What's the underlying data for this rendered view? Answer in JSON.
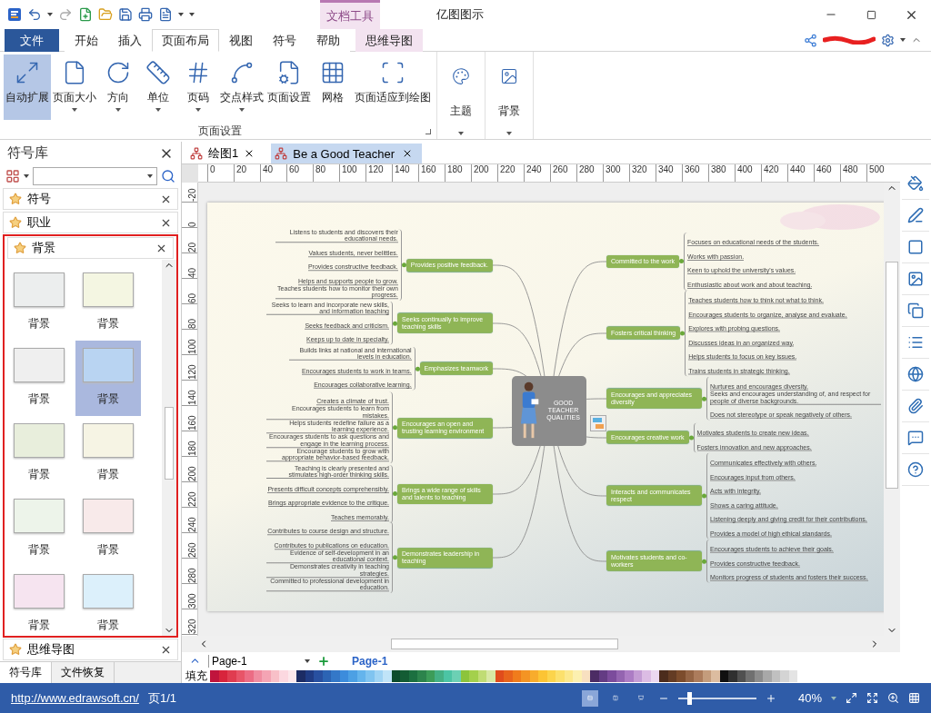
{
  "title_bar": {
    "title": "亿图图示",
    "context_tab": "文档工具"
  },
  "menu_tabs": [
    {
      "label": "文件",
      "kind": "file",
      "selected": false
    },
    {
      "label": "开始",
      "kind": "plain",
      "selected": false
    },
    {
      "label": "插入",
      "kind": "plain",
      "selected": false
    },
    {
      "label": "页面布局",
      "kind": "plain",
      "selected": true
    },
    {
      "label": "视图",
      "kind": "plain",
      "selected": false
    },
    {
      "label": "符号",
      "kind": "plain",
      "selected": false
    },
    {
      "label": "帮助",
      "kind": "plain",
      "selected": false
    },
    {
      "label": "思维导图",
      "kind": "context",
      "selected": false
    }
  ],
  "ribbon": {
    "groups": [
      {
        "label": "页面设置",
        "buttons": [
          {
            "label": "自动扩展",
            "selected": true,
            "dropdown": false
          },
          {
            "label": "页面大小",
            "selected": false,
            "dropdown": true
          },
          {
            "label": "方向",
            "selected": false,
            "dropdown": true
          },
          {
            "label": "单位",
            "selected": false,
            "dropdown": true
          },
          {
            "label": "页码",
            "selected": false,
            "dropdown": true
          },
          {
            "label": "交点样式",
            "selected": false,
            "dropdown": true
          },
          {
            "label": "页面设置",
            "selected": false,
            "dropdown": false
          },
          {
            "label": "网格",
            "selected": false,
            "dropdown": false
          },
          {
            "label": "页面适应到绘图",
            "selected": false,
            "dropdown": false
          }
        ]
      },
      {
        "buttons": [
          {
            "label": "主题",
            "selected": false,
            "dropdown": true
          }
        ]
      },
      {
        "buttons": [
          {
            "label": "背景",
            "selected": false,
            "dropdown": true
          }
        ]
      }
    ]
  },
  "library": {
    "title": "符号库",
    "sections": [
      {
        "label": "符号",
        "expanded": false,
        "highlighted": false
      },
      {
        "label": "职业",
        "expanded": false,
        "highlighted": false
      },
      {
        "label": "背景",
        "expanded": true,
        "highlighted": true
      },
      {
        "label": "思维导图",
        "expanded": false,
        "highlighted": false
      }
    ],
    "thumbnails": [
      {
        "label": "背景",
        "selected": false,
        "color": "#eceeee"
      },
      {
        "label": "背景",
        "selected": false,
        "color": "#f4f6e2"
      },
      {
        "label": "背景",
        "selected": false,
        "color": "#efefef"
      },
      {
        "label": "背景",
        "selected": true,
        "color": "#b9d4f2"
      },
      {
        "label": "背景",
        "selected": false,
        "color": "#e8eedc"
      },
      {
        "label": "背景",
        "selected": false,
        "color": "#f6f4e4"
      },
      {
        "label": "背景",
        "selected": false,
        "color": "#edf4ea"
      },
      {
        "label": "背景",
        "selected": false,
        "color": "#f8eaea"
      },
      {
        "label": "背景",
        "selected": false,
        "color": "#f6e4f0"
      },
      {
        "label": "背景",
        "selected": false,
        "color": "#dcf0fb"
      }
    ],
    "bottom_tabs": [
      {
        "label": "符号库",
        "selected": true
      },
      {
        "label": "文件恢复",
        "selected": false
      }
    ]
  },
  "document_tabs": [
    {
      "label": "绘图1",
      "selected": false
    },
    {
      "label": "Be a Good Teacher",
      "selected": true
    }
  ],
  "ruler": {
    "horizontal": [
      "0",
      "20",
      "40",
      "60",
      "80",
      "100",
      "120",
      "140",
      "160",
      "180",
      "200",
      "220",
      "240",
      "260",
      "280",
      "300",
      "320",
      "340",
      "360",
      "380",
      "400",
      "420",
      "440",
      "460",
      "480",
      "500"
    ],
    "vertical": [
      "-20",
      "0",
      "20",
      "40",
      "60",
      "80",
      "100",
      "120",
      "140",
      "160",
      "180",
      "200",
      "220",
      "240",
      "260",
      "280",
      "300",
      "320"
    ]
  },
  "mind_map": {
    "center": "GOOD TEACHER QUALITIES",
    "left": [
      {
        "label": "Provides positive feedback.",
        "children": [
          {
            "label": "Listens to students and discovers their educational needs."
          },
          {
            "label": "Values students, never belittles."
          },
          {
            "label": "Provides constructive feedback."
          },
          {
            "label": "Helps and supports people to grow."
          },
          {
            "label": "Teaches students how to monitor their own progress."
          }
        ]
      },
      {
        "label": "Seeks continually to improve teaching skills",
        "children": [
          {
            "label": "Seeks to learn and incorporate new skills, and information teaching"
          },
          {
            "label": "Seeks feedback and criticism."
          },
          {
            "label": "Keeps up to date in specialty."
          }
        ]
      },
      {
        "label": "Emphasizes teamwork",
        "children": [
          {
            "label": "Builds links at national and international levels in education."
          },
          {
            "label": "Encourages students to work in teams."
          },
          {
            "label": "Encourages collaborative learning."
          }
        ]
      },
      {
        "label": "Encourages an open and trusting learning environment",
        "children": [
          {
            "label": "Creates a climate of trust."
          },
          {
            "label": "Encourages students to learn from mistakes."
          },
          {
            "label": "Helps students redefine failure as a learning experience."
          },
          {
            "label": "Encourages students to ask questions and engage in the learning process."
          },
          {
            "label": "Encourage students to grow with appropriate behavior-based feedback."
          }
        ]
      },
      {
        "label": "Brings a wide range of skills and talents to teaching",
        "children": [
          {
            "label": "Teaching is clearly presented and stimulates high-order thinking skills."
          },
          {
            "label": "Presents difficult concepts comprehensibly."
          },
          {
            "label": "Brings appropriate evidence to the critique."
          },
          {
            "label": "Teaches memorably."
          }
        ]
      },
      {
        "label": "Demonstrates leadership in teaching",
        "children": [
          {
            "label": "Contributes to course design and structure."
          },
          {
            "label": "Contributes to publications on education."
          },
          {
            "label": "Evidence of self-development in an educational context."
          },
          {
            "label": "Demonstrates creativity in teaching strategies."
          },
          {
            "label": "Committed to professional development in education."
          }
        ]
      }
    ],
    "right": [
      {
        "label": "Committed to the work",
        "children": [
          {
            "label": "Focuses on educational needs of the students."
          },
          {
            "label": "Works with passion."
          },
          {
            "label": "Keen to uphold the university's values."
          },
          {
            "label": "Enthusiastic about work and about teaching."
          }
        ]
      },
      {
        "label": "Fosters critical thinking",
        "children": [
          {
            "label": "Teaches students how to think not what to think."
          },
          {
            "label": "Encourages students to organize, analyse and evaluate."
          },
          {
            "label": "Explores with probing questions."
          },
          {
            "label": "Discusses ideas in an organized way."
          },
          {
            "label": "Helps students to focus on key issues."
          },
          {
            "label": "Trains students in strategic thinking."
          }
        ]
      },
      {
        "label": "Encourages and appreciates diversity",
        "children": [
          {
            "label": "Nurtures and encourages diversity."
          },
          {
            "label": "Seeks and encourages understanding of, and respect for people of diverse backgrounds."
          },
          {
            "label": "Does not stereotype or speak negatively of others."
          }
        ]
      },
      {
        "label": "Encourages creative work",
        "children": [
          {
            "label": "Motivates students to create new ideas."
          },
          {
            "label": "Fosters innovation and new approaches."
          }
        ]
      },
      {
        "label": "Interacts and communicates respect",
        "children": [
          {
            "label": "Communicates effectively with others."
          },
          {
            "label": "Encourages input from others."
          },
          {
            "label": "Acts with integrity."
          },
          {
            "label": "Shows a caring attitude."
          },
          {
            "label": "Listening deeply and giving credit for their contributions."
          },
          {
            "label": "Provides a model of high ethical standards."
          }
        ]
      },
      {
        "label": "Motivates students and co-workers",
        "children": [
          {
            "label": "Encourages students to achieve their goals."
          },
          {
            "label": "Provides constructive feedback."
          },
          {
            "label": "Monitors progress of students and fosters their success."
          }
        ]
      }
    ]
  },
  "page_bar": {
    "page_select": "Page-1",
    "pages": [
      {
        "label": "Page-1",
        "selected": true
      }
    ]
  },
  "fill_palette": {
    "label": "填充",
    "swatches": [
      {
        "color": "#c0143c"
      },
      {
        "color": "#d8243c"
      },
      {
        "color": "#e03c50"
      },
      {
        "color": "#e85468"
      },
      {
        "color": "#ec6c84"
      },
      {
        "color": "#f08ca0"
      },
      {
        "color": "#f4a4b4"
      },
      {
        "color": "#f8c0c8"
      },
      {
        "color": "#fcd8e0"
      },
      {
        "color": "#fce8ec"
      },
      {
        "color": "#1c2c64"
      },
      {
        "color": "#203c84"
      },
      {
        "color": "#2850a0"
      },
      {
        "color": "#2c64b4"
      },
      {
        "color": "#3478c8"
      },
      {
        "color": "#3c8cdc"
      },
      {
        "color": "#4ca0e4"
      },
      {
        "color": "#64b4ec"
      },
      {
        "color": "#80c4f0"
      },
      {
        "color": "#a0d4f4"
      },
      {
        "color": "#c0e4f8"
      },
      {
        "color": "#0c4c2c"
      },
      {
        "color": "#145c34"
      },
      {
        "color": "#1c7040"
      },
      {
        "color": "#2c844c"
      },
      {
        "color": "#3c9c58"
      },
      {
        "color": "#44b084"
      },
      {
        "color": "#4cc4a4"
      },
      {
        "color": "#6cd0b4"
      },
      {
        "color": "#8cc43c"
      },
      {
        "color": "#a4d04c"
      },
      {
        "color": "#c0dc74"
      },
      {
        "color": "#d8e8a4"
      },
      {
        "color": "#e04c1c"
      },
      {
        "color": "#e8641c"
      },
      {
        "color": "#f07c1c"
      },
      {
        "color": "#f49424"
      },
      {
        "color": "#f8ac2c"
      },
      {
        "color": "#fcc434"
      },
      {
        "color": "#fcd44c"
      },
      {
        "color": "#fce06c"
      },
      {
        "color": "#fce88c"
      },
      {
        "color": "#fcf0b0"
      },
      {
        "color": "#f8e0c0"
      },
      {
        "color": "#4c2c64"
      },
      {
        "color": "#643c84"
      },
      {
        "color": "#7c4c9c"
      },
      {
        "color": "#9464b0"
      },
      {
        "color": "#ac7cc4"
      },
      {
        "color": "#c49cd4"
      },
      {
        "color": "#dcbce4"
      },
      {
        "color": "#ecd8f0"
      },
      {
        "color": "#4c2c1c"
      },
      {
        "color": "#643c24"
      },
      {
        "color": "#7c4c2c"
      },
      {
        "color": "#946444"
      },
      {
        "color": "#ac7c5c"
      },
      {
        "color": "#c49c7c"
      },
      {
        "color": "#dcbca0"
      },
      {
        "color": "#101010"
      },
      {
        "color": "#303030"
      },
      {
        "color": "#505050"
      },
      {
        "color": "#707070"
      },
      {
        "color": "#8c8c8c"
      },
      {
        "color": "#a8a8a8"
      },
      {
        "color": "#c0c0c0"
      },
      {
        "color": "#d4d4d4"
      },
      {
        "color": "#e4e4e4"
      }
    ]
  },
  "status_bar": {
    "link": "http://www.edrawsoft.cn/",
    "page_count": "页1/1",
    "views": [
      {
        "selected": true
      },
      {
        "selected": false
      },
      {
        "selected": false
      }
    ],
    "zoom": {
      "level": 0.12,
      "reading": "40%"
    }
  }
}
